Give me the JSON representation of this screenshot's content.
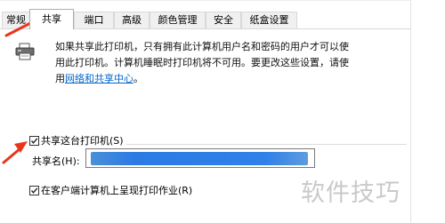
{
  "tabs": [
    {
      "label": "常规",
      "active": false
    },
    {
      "label": "共享",
      "active": true
    },
    {
      "label": "端口",
      "active": false
    },
    {
      "label": "高级",
      "active": false
    },
    {
      "label": "颜色管理",
      "active": false
    },
    {
      "label": "安全",
      "active": false
    },
    {
      "label": "纸盒设置",
      "active": false
    }
  ],
  "description": {
    "line1": "如果共享此打印机，只有拥有此计算机用户名和密码的用户才可以使",
    "line2": "用此打印机。计算机睡眠时打印机将不可用。要更改这些设置，请使",
    "line3_prefix": "用",
    "link": "网络和共享中心",
    "line3_suffix": "。"
  },
  "share_printer": {
    "label": "共享这台打印机(S)",
    "checked": true
  },
  "share_name": {
    "label": "共享名(H):",
    "value": ""
  },
  "render_jobs": {
    "label": "在客户端计算机上呈现打印作业(R)",
    "checked": true
  },
  "watermark": "软件技巧",
  "colors": {
    "link": "#0066cc",
    "arrow": "#e8361c",
    "redaction": "#2f80e8"
  },
  "icons": {
    "printer": "printer-icon",
    "checkmark": "checkmark-icon",
    "arrow": "arrow-annotation"
  }
}
